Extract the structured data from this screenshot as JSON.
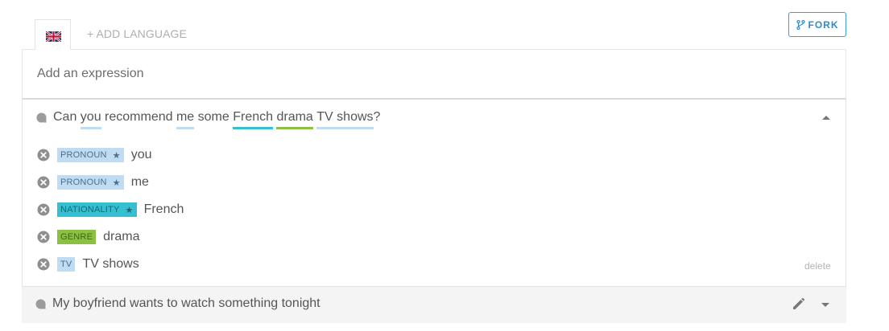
{
  "tabs": {
    "active_language_icon": "uk-flag-icon",
    "add_language_label": "+ ADD LANGUAGE"
  },
  "fork": {
    "icon": "fork-icon",
    "label": "FORK",
    "color": "#2d8ccb"
  },
  "expression_input": {
    "placeholder": "Add an expression",
    "value": ""
  },
  "expanded_expression": {
    "segments": [
      {
        "text": "Can ",
        "entity": null
      },
      {
        "text": "you",
        "entity": "pronoun"
      },
      {
        "text": " recommend ",
        "entity": null
      },
      {
        "text": "me",
        "entity": "pronoun"
      },
      {
        "text": " some ",
        "entity": null
      },
      {
        "text": "French",
        "entity": "nationality"
      },
      {
        "text": " ",
        "entity": null
      },
      {
        "text": "drama",
        "entity": "genre"
      },
      {
        "text": " ",
        "entity": null
      },
      {
        "text": "TV shows",
        "entity": "tv"
      },
      {
        "text": "?",
        "entity": null
      }
    ],
    "entities": [
      {
        "tag": "PRONOUN",
        "starred": true,
        "star": "★",
        "value": "you",
        "kind": "pronoun"
      },
      {
        "tag": "PRONOUN",
        "starred": true,
        "star": "★",
        "value": "me",
        "kind": "pronoun"
      },
      {
        "tag": "NATIONALITY",
        "starred": true,
        "star": "★",
        "value": "French",
        "kind": "nationality"
      },
      {
        "tag": "GENRE",
        "starred": false,
        "star": "",
        "value": "drama",
        "kind": "genre"
      },
      {
        "tag": "TV",
        "starred": false,
        "star": "",
        "value": "TV shows",
        "kind": "tv"
      }
    ],
    "delete_label": "delete"
  },
  "collapsed_expression": {
    "text": "My boyfriend wants to watch something tonight"
  },
  "colors": {
    "pronoun": "#bfdcf3",
    "nationality": "#35bfd0",
    "genre": "#8cc043",
    "tv": "#bfdcf3",
    "accent": "#3d9fd7"
  }
}
